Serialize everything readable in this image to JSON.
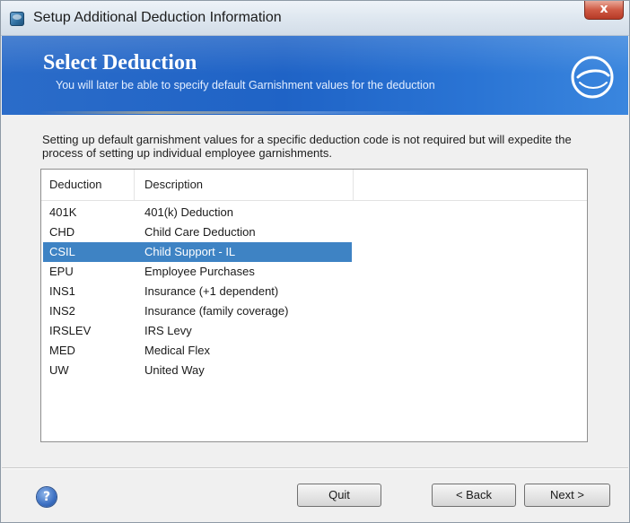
{
  "window": {
    "title": "Setup Additional Deduction Information",
    "close_label": "x"
  },
  "banner": {
    "title": "Select Deduction",
    "subtitle": "You will later be able to specify default Garnishment values for the deduction",
    "logo_icon": "e-swirl-logo-icon"
  },
  "intro_text": "Setting up default garnishment values for a specific deduction code is not required but will expedite the process of setting up individual employee garnishments.",
  "list": {
    "columns": [
      "Deduction",
      "Description"
    ],
    "rows": [
      {
        "code": "401K",
        "description": "401(k) Deduction"
      },
      {
        "code": "CHD",
        "description": "Child Care Deduction"
      },
      {
        "code": "CSIL",
        "description": "Child Support - IL"
      },
      {
        "code": "EPU",
        "description": "Employee Purchases"
      },
      {
        "code": "INS1",
        "description": "Insurance (+1 dependent)"
      },
      {
        "code": "INS2",
        "description": "Insurance (family coverage)"
      },
      {
        "code": "IRSLEV",
        "description": "IRS Levy"
      },
      {
        "code": "MED",
        "description": "Medical Flex"
      },
      {
        "code": "UW",
        "description": "United Way"
      }
    ],
    "selected_code": "CSIL"
  },
  "footer": {
    "help_label": "?",
    "quit_label": "Quit",
    "back_label": "< Back",
    "next_label": "Next >"
  },
  "colors": {
    "banner_blue": "#1f63c6",
    "selection_blue": "#3e83c4"
  }
}
